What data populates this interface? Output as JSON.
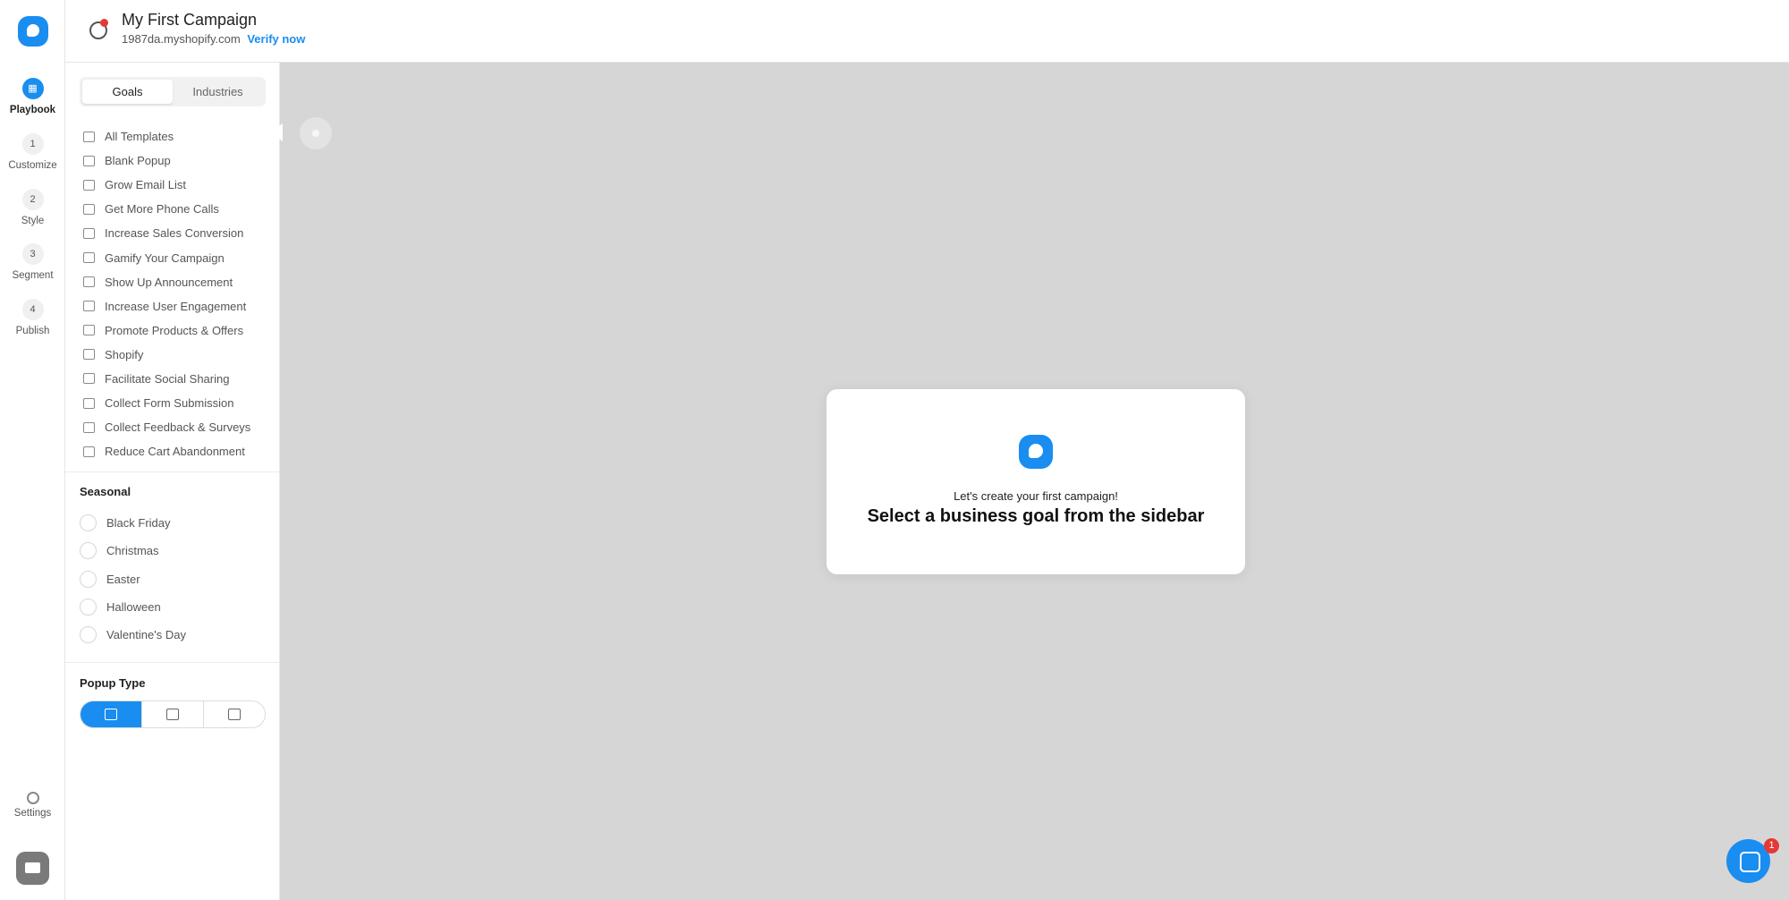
{
  "header": {
    "campaign_title": "My First Campaign",
    "shop_url": "1987da.myshopify.com",
    "verify_label": "Verify now"
  },
  "rail": {
    "steps": [
      {
        "num": "",
        "label": "Playbook"
      },
      {
        "num": "1",
        "label": "Customize"
      },
      {
        "num": "2",
        "label": "Style"
      },
      {
        "num": "3",
        "label": "Segment"
      },
      {
        "num": "4",
        "label": "Publish"
      }
    ],
    "settings_label": "Settings"
  },
  "sidebar": {
    "tabs": [
      "Goals",
      "Industries"
    ],
    "goals": [
      "All Templates",
      "Blank Popup",
      "Grow Email List",
      "Get More Phone Calls",
      "Increase Sales Conversion",
      "Gamify Your Campaign",
      "Show Up Announcement",
      "Increase User Engagement",
      "Promote Products & Offers",
      "Shopify",
      "Facilitate Social Sharing",
      "Collect Form Submission",
      "Collect Feedback & Surveys",
      "Reduce Cart Abandonment"
    ],
    "seasonal_title": "Seasonal",
    "seasonal": [
      "Black Friday",
      "Christmas",
      "Easter",
      "Halloween",
      "Valentine's Day"
    ],
    "popup_type_title": "Popup Type"
  },
  "canvas": {
    "card_sub": "Let's create your first campaign!",
    "card_title": "Select a business goal from the sidebar"
  },
  "chat": {
    "badge": "1"
  },
  "colors": {
    "accent": "#1a8df0",
    "canvas_bg": "#d6d6d6",
    "badge": "#e53935"
  }
}
